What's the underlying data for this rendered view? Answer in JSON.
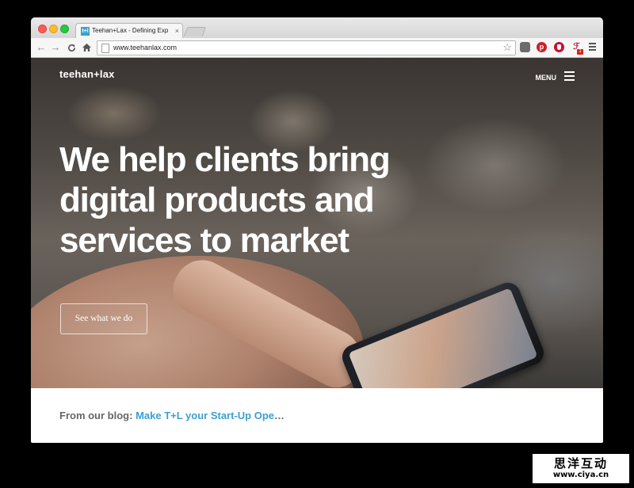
{
  "browser": {
    "tab_title": "Teehan+Lax - Defining Exp",
    "tab_close": "×",
    "favicon_text": "t+l",
    "url": "www.teehanlax.com",
    "star_glyph": "☆",
    "extensions": [
      "pocket-icon",
      "pinterest-icon",
      "adblock-icon",
      "lastpass-icon"
    ],
    "pinterest_glyph": "p",
    "lastpass_glyph": "ℱ",
    "ext_badge": "1",
    "back_glyph": "←",
    "forward_glyph": "→",
    "reload_glyph": "C"
  },
  "site": {
    "logo": "teehan+lax",
    "menu_label": "MENU",
    "headline": "We help clients bring digital products and services to market",
    "cta_label": "See what we do",
    "blog_prefix": "From our blog:",
    "blog_link": "Make T+L your Start-Up Ope",
    "blog_ellipsis": "…"
  },
  "watermark": {
    "text_cn": "思洋互动",
    "url": "www.ciya.cn"
  },
  "colors": {
    "accent": "#3d9fd1",
    "page_bg": "#000000"
  }
}
